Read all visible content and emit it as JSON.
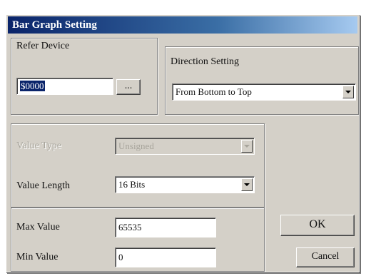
{
  "dialog": {
    "title": "Bar Graph Setting"
  },
  "read_device": {
    "label": "Refer Device",
    "value": "$0000",
    "browse_label": "..."
  },
  "direction": {
    "label": "Direction Setting",
    "selected": "From Bottom to Top"
  },
  "value_type": {
    "label": "Value Type",
    "selected": "Unsigned"
  },
  "value_length": {
    "label": "Value Length",
    "selected": "16 Bits"
  },
  "max_value": {
    "label": "Max Value",
    "value": "65535"
  },
  "min_value": {
    "label": "Min Value",
    "value": "0"
  },
  "buttons": {
    "ok": "OK",
    "cancel": "Cancel"
  }
}
